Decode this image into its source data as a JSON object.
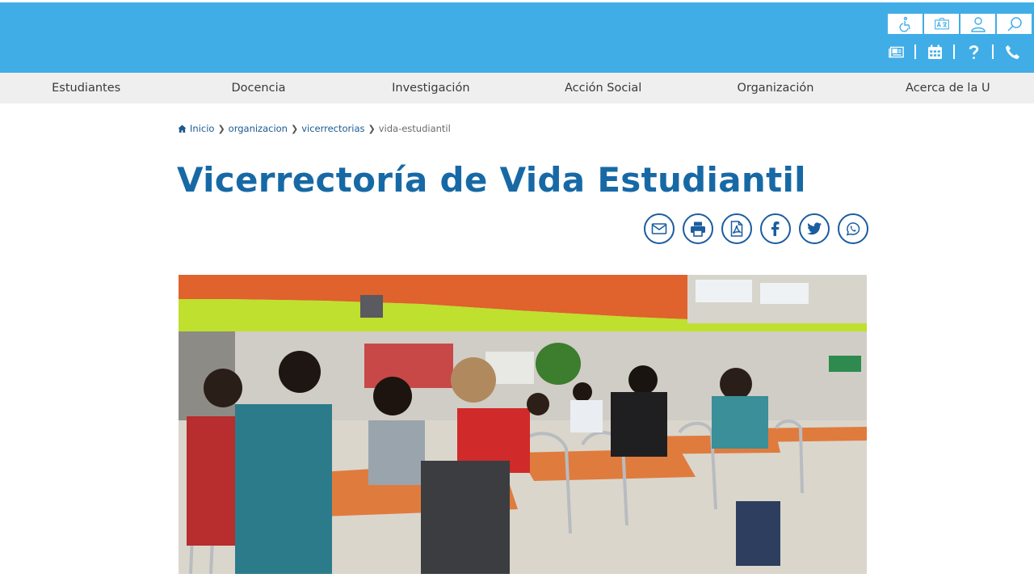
{
  "utility_top": [
    "accessibility-icon",
    "translate-icon",
    "user-icon",
    "search-icon"
  ],
  "utility_bottom": [
    "newspaper-icon",
    "calendar-icon",
    "help-icon",
    "phone-icon"
  ],
  "nav": {
    "items": [
      "Estudiantes",
      "Docencia",
      "Investigación",
      "Acción Social",
      "Organización",
      "Acerca de la U"
    ]
  },
  "breadcrumb": {
    "home": "Inicio",
    "level1": "organizacion",
    "level2": "vicerrectorias",
    "current": "vida-estudiantil"
  },
  "page": {
    "title": "Vicerrectoría de Vida Estudiantil"
  },
  "share": [
    "email-icon",
    "print-icon",
    "pdf-icon",
    "facebook-icon",
    "twitter-icon",
    "whatsapp-icon"
  ],
  "colors": {
    "header_bg": "#41ade7",
    "nav_bg": "#efefef",
    "title": "#1769a6",
    "share_stroke": "#1b5da0"
  }
}
